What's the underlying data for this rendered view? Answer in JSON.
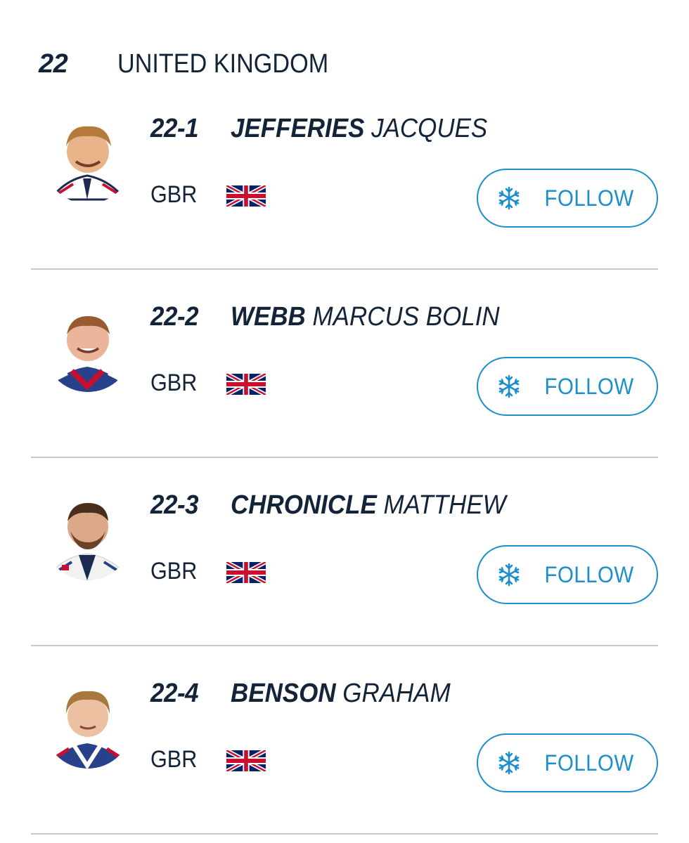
{
  "team": {
    "number": "22",
    "name": "UNITED KINGDOM"
  },
  "accent_color": "#1b8fc9",
  "text_color": "#132338",
  "athletes": [
    {
      "bib": "22-1",
      "last_name": "JEFFERIES",
      "first_name": "JACQUES",
      "nation": "GBR",
      "flag_icon": "uk-flag-icon",
      "follow_label": "FOLLOW",
      "follow_icon": "snowflake-icon"
    },
    {
      "bib": "22-2",
      "last_name": "WEBB",
      "first_name": "MARCUS BOLIN",
      "nation": "GBR",
      "flag_icon": "uk-flag-icon",
      "follow_label": "FOLLOW",
      "follow_icon": "snowflake-icon"
    },
    {
      "bib": "22-3",
      "last_name": "CHRONICLE",
      "first_name": "MATTHEW",
      "nation": "GBR",
      "flag_icon": "uk-flag-icon",
      "follow_label": "FOLLOW",
      "follow_icon": "snowflake-icon"
    },
    {
      "bib": "22-4",
      "last_name": "BENSON",
      "first_name": "GRAHAM",
      "nation": "GBR",
      "flag_icon": "uk-flag-icon",
      "follow_label": "FOLLOW",
      "follow_icon": "snowflake-icon"
    }
  ]
}
